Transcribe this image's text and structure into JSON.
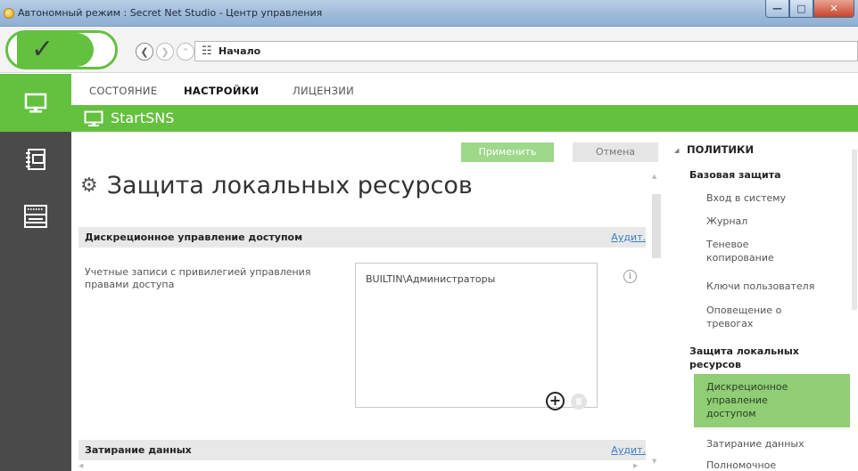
{
  "window": {
    "title": "Автономный режим : Secret Net Studio - Центр управления"
  },
  "toolbar": {
    "address": "Начало"
  },
  "tabs": [
    {
      "label": "СОСТОЯНИЕ",
      "active": false
    },
    {
      "label": "НАСТРОЙКИ",
      "active": true
    },
    {
      "label": "ЛИЦЕНЗИИ",
      "active": false
    }
  ],
  "header": {
    "title": "StartSNS"
  },
  "actions": {
    "apply": "Применить",
    "cancel": "Отмена"
  },
  "page": {
    "title": "Защита локальных ресурсов"
  },
  "sections": [
    {
      "title": "Дискреционное управление доступом",
      "link": "Аудит."
    },
    {
      "title": "Затирание данных",
      "link": "Аудит."
    }
  ],
  "field": {
    "label": "Учетные записи с привилегией управления правами доступа",
    "values": [
      "BUILTIN\\Администраторы"
    ]
  },
  "tree": {
    "root": "ПОЛИТИКИ",
    "groups": [
      {
        "label": "Базовая защита",
        "items": [
          "Вход в систему",
          "Журнал",
          "Теневое копирование",
          "Ключи пользователя",
          "Оповещение о тревогах"
        ]
      },
      {
        "label": "Защита локальных ресурсов",
        "items": [
          "Дискреционное управление доступом",
          "Затирание данных",
          "Полномочное"
        ]
      }
    ],
    "selected": "Дискреционное управление доступом"
  },
  "colors": {
    "accent": "#64c13f",
    "rail": "#4a4a4a",
    "link": "#3a7fc4"
  }
}
